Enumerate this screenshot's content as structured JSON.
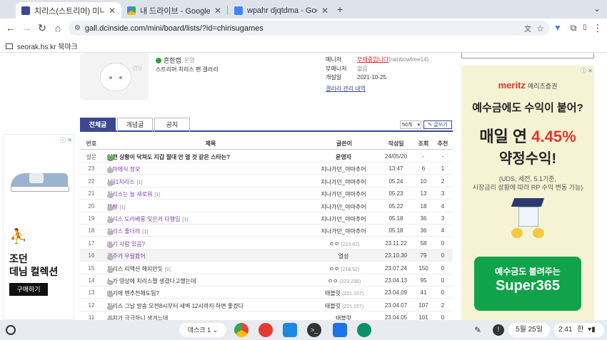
{
  "tabs": [
    {
      "title": "치리스(스트리머) 미니 갤러리 -",
      "active": true
    },
    {
      "title": "내 드라이브 - Google Drive",
      "active": false
    },
    {
      "title": "wpahr djqtdma - Google Docs",
      "active": false
    }
  ],
  "new_tab": "+",
  "url": "gall.dcinside.com/mini/board/lists/?id=chirisugames",
  "bookmark": "seorak.hs.kr 북마크",
  "gallery": {
    "logo_text": "mi",
    "owner_name": "흔한캡",
    "owner_badge": "운영",
    "description": "스트리머 치리스 팬 갤러리",
    "manager_label": "매니저",
    "manager_value": "부재중입니다",
    "manager_id": "(rainbowtree14)",
    "submanager_label": "부매니저",
    "submanager_value": "없음",
    "opened_label": "개설일",
    "opened_value": "2021-10-25",
    "manage_link": "갤러리 관리 내역"
  },
  "board_tabs": [
    "전체글",
    "개념글",
    "공지"
  ],
  "list_count": "50개",
  "write_button": "글쓰기",
  "columns": [
    "번호",
    "제목",
    "글쓴이",
    "작성일",
    "조회",
    "추천"
  ],
  "rows": [
    {
      "num": "설문",
      "title": "어떤 상황이 닥쳐도 지갑 절대 안 열 것 같은 스타는?",
      "reply": "",
      "writer": "운영자",
      "ip": "",
      "date": "24/05/20",
      "views": "-",
      "rec": "-",
      "bold": true
    },
    {
      "num": "23",
      "title": "슈마메식 정모",
      "reply": "",
      "writer": "지나가던_야마추어",
      "ip": "",
      "date": "13:47",
      "views": "6",
      "rec": "1",
      "purple": true
    },
    {
      "num": "22",
      "title": "1일1치리스",
      "reply": "[1]",
      "writer": "지나가던_야마추어",
      "ip": "",
      "date": "05.24",
      "views": "10",
      "rec": "2",
      "purple": true
    },
    {
      "num": "21",
      "title": "치리스는 늘 새로워",
      "reply": "[1]",
      "writer": "지나가던_야마추어",
      "ip": "",
      "date": "05.23",
      "views": "13",
      "rec": "3",
      "purple": true
    },
    {
      "num": "20",
      "title": "뿌빵",
      "reply": "[1]",
      "writer": "지나가던_야마추어",
      "ip": "",
      "date": "05.22",
      "views": "18",
      "rec": "4",
      "purple": true
    },
    {
      "num": "19",
      "title": "치리스 도라베룽 잊은거 다행임",
      "reply": "[1]",
      "writer": "지나가던_야마추어",
      "ip": "",
      "date": "05.18",
      "views": "36",
      "rec": "3",
      "purple": true
    },
    {
      "num": "18",
      "title": "치리스 좋더라",
      "reply": "[1]",
      "writer": "지나가던_야마추어",
      "ip": "",
      "date": "05.18",
      "views": "36",
      "rec": "4",
      "purple": true
    },
    {
      "num": "17",
      "title": "여기 사람 있음?",
      "reply": "",
      "writer": "ㅇㅇ",
      "ip": "(223.62)",
      "date": "23.11.22",
      "views": "58",
      "rec": "0",
      "purple": true
    },
    {
      "num": "16",
      "title": "갤주가 우릴봤어",
      "reply": "",
      "writer": "열성",
      "ip": "",
      "date": "23.10.30",
      "views": "79",
      "rec": "0",
      "purple": true,
      "highlight": true
    },
    {
      "num": "15",
      "title": "치리스 리액션 헤지만듯",
      "reply": "[1]",
      "writer": "ㅇㅇ",
      "ip": "(218.52)",
      "date": "23.07.24",
      "views": "150",
      "rec": "0"
    },
    {
      "num": "14",
      "title": "누가 영상에 치리스짤 생겼다고했는데",
      "reply": "",
      "writer": "ㅇㅇ",
      "ip": "(222.236)",
      "date": "23.04.13",
      "views": "95",
      "rec": "0"
    },
    {
      "num": "13",
      "title": "여기에 멘추천해도됨?",
      "reply": "",
      "writer": "태블릿",
      "ip": "(221.157)",
      "date": "23.04.09",
      "views": "41",
      "rec": "0"
    },
    {
      "num": "12",
      "title": "치리스 그날 방송 오전8시부터 새벽 12시까지 하면 좋겠다",
      "reply": "",
      "writer": "태블릿",
      "ip": "(221.157)",
      "date": "23.04.07",
      "views": "107",
      "rec": "2"
    },
    {
      "num": "11",
      "title": "가치가 극극하니 생겨느데",
      "reply": "",
      "writer": "태블릿",
      "ip": "",
      "date": "23.04.05",
      "views": "101",
      "rec": "0"
    }
  ],
  "ad_left": {
    "title1": "조던",
    "title2": "데님 컬렉션",
    "cta": "구매하기"
  },
  "ad_right": {
    "brand": "meritz",
    "brand_sub": "메리츠증권",
    "headline1": "예수금에도 수익이 붙어?",
    "headline2a": "매일 연",
    "rate": "4.45%",
    "headline3": "약정수익!",
    "note1": "(UDS, 세전, 5.1기준,",
    "note2": "시장금리 상황에 따라 RP 수익 변동 가능)",
    "cta1": "예수금도 불려주는",
    "cta2": "Super365"
  },
  "shelf": {
    "desk": "데스크 1",
    "date": "5월 25일",
    "time": "2:41",
    "ime": "한"
  },
  "colors": {
    "accent": "#3b4890",
    "tab_bg": "#dde3ea",
    "meritz_red": "#e0342d",
    "ad_bg": "#f6f3d4",
    "cta_green": "#11a34a"
  }
}
